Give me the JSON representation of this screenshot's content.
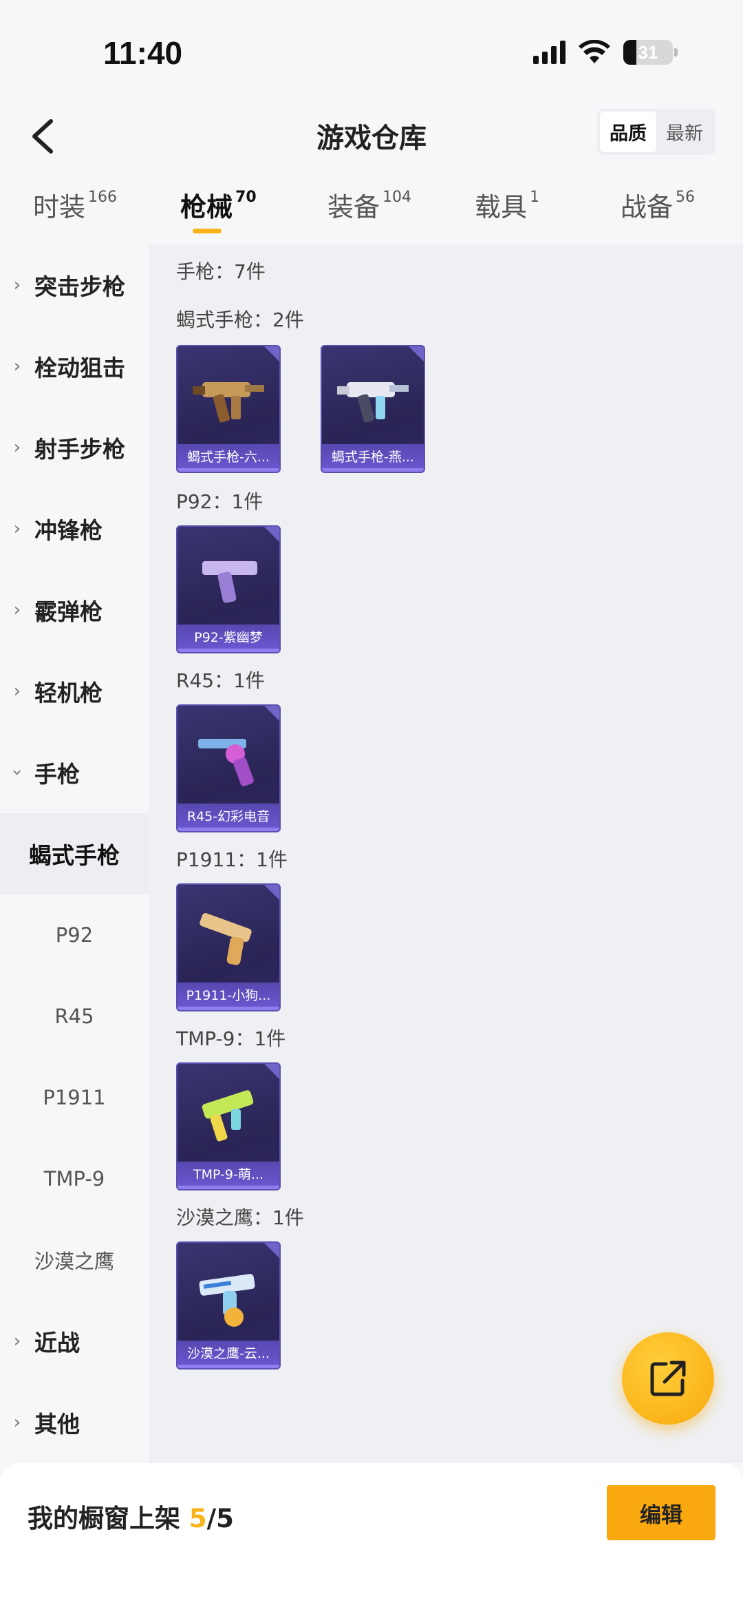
{
  "status_bar": {
    "time": "11:40",
    "battery": "31"
  },
  "header": {
    "title": "游戏仓库",
    "sort_options": [
      "品质",
      "最新"
    ]
  },
  "tabs": [
    {
      "label": "时装",
      "count": "166"
    },
    {
      "label": "枪械",
      "count": "70"
    },
    {
      "label": "装备",
      "count": "104"
    },
    {
      "label": "载具",
      "count": "1"
    },
    {
      "label": "战备",
      "count": "56"
    }
  ],
  "sidebar": {
    "categories": [
      "突击步枪",
      "栓动狙击",
      "射手步枪",
      "冲锋枪",
      "霰弹枪",
      "轻机枪",
      "手枪"
    ],
    "sub_items": [
      "蝎式手枪",
      "P92",
      "R45",
      "P1911",
      "TMP-9",
      "沙漠之鹰"
    ],
    "after": [
      "近战",
      "其他"
    ]
  },
  "content": {
    "total_label": "手枪：7件",
    "groups": [
      {
        "label": "蝎式手枪：2件",
        "items": [
          "蝎式手枪-六...",
          "蝎式手枪-燕..."
        ]
      },
      {
        "label": "P92：1件",
        "items": [
          "P92-紫幽梦"
        ]
      },
      {
        "label": "R45：1件",
        "items": [
          "R45-幻彩电音"
        ]
      },
      {
        "label": "P1911：1件",
        "items": [
          "P1911-小狗..."
        ]
      },
      {
        "label": "TMP-9：1件",
        "items": [
          "TMP-9-萌..."
        ]
      },
      {
        "label": "沙漠之鹰：1件",
        "items": [
          "沙漠之鹰-云..."
        ]
      }
    ]
  },
  "bottom_bar": {
    "label": "我的橱窗上架",
    "current": "5",
    "total": "/5",
    "edit_label": "编辑"
  },
  "colors": {
    "accent": "#f7b419",
    "card_bg": "#2a2555",
    "card_label": "#6c58d2"
  }
}
